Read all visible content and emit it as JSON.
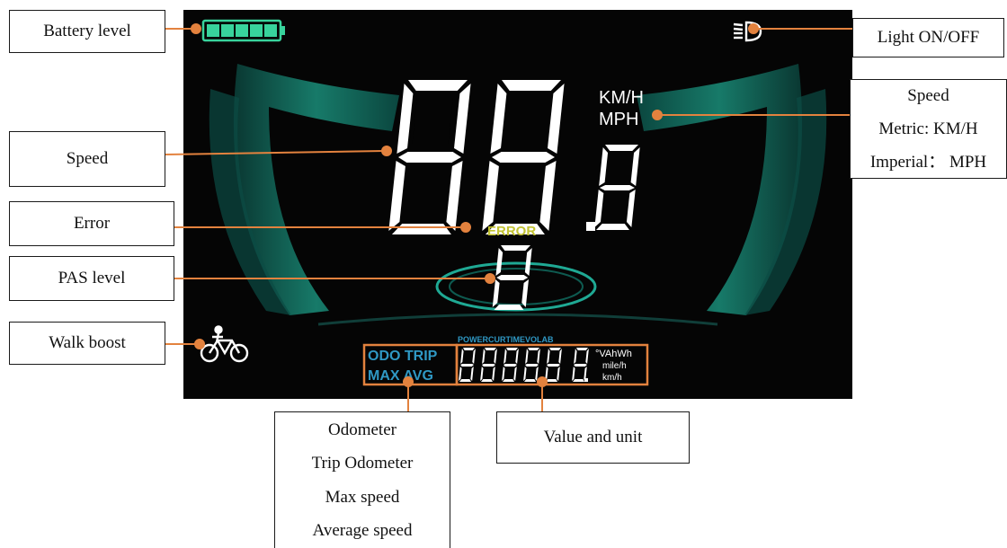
{
  "labels": {
    "battery": "Battery level",
    "light": "Light ON/OFF",
    "speed_left": "Speed",
    "speed_right": [
      "Speed",
      "Metric: KM/H",
      "Imperial： MPH"
    ],
    "error": "Error",
    "pas": "PAS level",
    "walk": "Walk boost",
    "modes": [
      "Odometer",
      "Trip Odometer",
      "Max speed",
      "Average speed"
    ],
    "value_unit": "Value and unit"
  },
  "display": {
    "speed_unit_metric": "KM/H",
    "speed_unit_imperial": "MPH",
    "error_text": "ERROR",
    "mode_row1": "ODO TRIP",
    "mode_row2": "MAX AVG",
    "top_indicators": "POWERCURTIMEVOLAB",
    "value_units_row1": "°VAhWh",
    "value_units_row2": "mile/h",
    "value_units_row3": "km/h"
  },
  "colors": {
    "leader_line": "#e3823e",
    "battery_green": "#38d39c",
    "teal": "#1fa994",
    "error_yellow": "#c2c232",
    "mode_blue": "#2f98c4"
  },
  "icons": [
    "battery-icon",
    "headlight-icon",
    "walk-assist-bike-icon"
  ]
}
